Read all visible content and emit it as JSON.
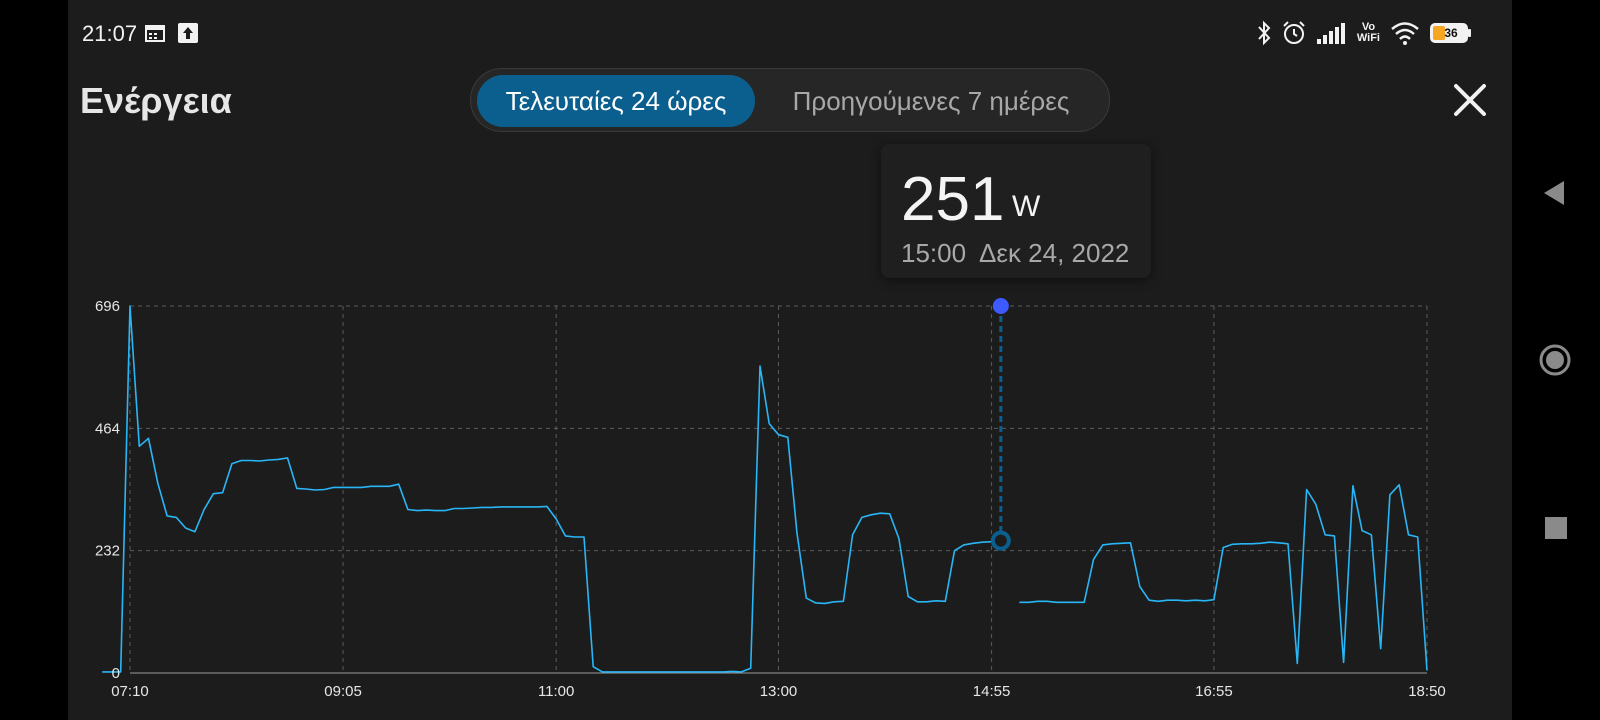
{
  "status_bar": {
    "time": "21:07",
    "battery": "36",
    "vowifi_top": "Vo",
    "vowifi_bottom": "WiFi",
    "icons": [
      "calendar-icon",
      "upload-icon",
      "bluetooth-icon",
      "alarm-icon",
      "cellular-signal-icon",
      "wifi-icon",
      "battery-icon"
    ]
  },
  "header": {
    "title": "Ενέργεια",
    "tabs": [
      {
        "label": "Τελευταίες 24 ώρες",
        "selected": true
      },
      {
        "label": "Προηγούμενες 7 ημέρες",
        "selected": false
      }
    ],
    "close_icon": "close-icon"
  },
  "tooltip": {
    "value": "251",
    "unit": "W",
    "time": "15:00",
    "date": "Δεκ 24, 2022"
  },
  "colors": {
    "accent": "#0a5f8e",
    "line": "#29b6f6",
    "marker": "#3d5afe",
    "background": "#1c1c1c"
  },
  "chart_data": {
    "type": "line",
    "x_tick_labels": [
      "07:10",
      "09:05",
      "11:00",
      "13:00",
      "14:55",
      "16:55",
      "18:50"
    ],
    "x_range": [
      "07:10",
      "18:50"
    ],
    "ylim": [
      0,
      696
    ],
    "y_ticks": [
      0,
      232,
      464,
      696
    ],
    "grid": true,
    "selected_point": {
      "x": "15:00",
      "y": 251
    },
    "series": [
      {
        "values": [
          [
            "06:55",
            2
          ],
          [
            "07:05",
            2
          ],
          [
            "07:10",
            696
          ],
          [
            "07:15",
            430
          ],
          [
            "07:20",
            445
          ],
          [
            "07:25",
            360
          ],
          [
            "07:30",
            298
          ],
          [
            "07:35",
            295
          ],
          [
            "07:40",
            275
          ],
          [
            "07:45",
            268
          ],
          [
            "07:50",
            310
          ],
          [
            "07:55",
            340
          ],
          [
            "08:00",
            342
          ],
          [
            "08:05",
            397
          ],
          [
            "08:10",
            403
          ],
          [
            "08:15",
            403
          ],
          [
            "08:20",
            402
          ],
          [
            "08:25",
            404
          ],
          [
            "08:30",
            405
          ],
          [
            "08:35",
            408
          ],
          [
            "08:40",
            350
          ],
          [
            "08:45",
            349
          ],
          [
            "08:50",
            347
          ],
          [
            "08:55",
            348
          ],
          [
            "09:00",
            352
          ],
          [
            "09:05",
            352
          ],
          [
            "09:10",
            352
          ],
          [
            "09:15",
            352
          ],
          [
            "09:20",
            354
          ],
          [
            "09:25",
            354
          ],
          [
            "09:30",
            354
          ],
          [
            "09:35",
            358
          ],
          [
            "09:40",
            310
          ],
          [
            "09:45",
            308
          ],
          [
            "09:50",
            309
          ],
          [
            "09:55",
            308
          ],
          [
            "10:00",
            308
          ],
          [
            "10:05",
            312
          ],
          [
            "10:10",
            312
          ],
          [
            "10:15",
            313
          ],
          [
            "10:20",
            314
          ],
          [
            "10:25",
            314
          ],
          [
            "10:30",
            315
          ],
          [
            "10:35",
            315
          ],
          [
            "10:40",
            315
          ],
          [
            "10:45",
            315
          ],
          [
            "10:50",
            315
          ],
          [
            "10:55",
            316
          ],
          [
            "11:00",
            292
          ],
          [
            "11:05",
            260
          ],
          [
            "11:10",
            258
          ],
          [
            "11:15",
            258
          ],
          [
            "11:20",
            12
          ],
          [
            "11:25",
            2
          ],
          [
            "11:30",
            2
          ],
          [
            "11:35",
            2
          ],
          [
            "11:40",
            2
          ],
          [
            "11:45",
            2
          ],
          [
            "11:50",
            2
          ],
          [
            "11:55",
            2
          ],
          [
            "12:00",
            2
          ],
          [
            "12:05",
            2
          ],
          [
            "12:10",
            2
          ],
          [
            "12:15",
            2
          ],
          [
            "12:20",
            2
          ],
          [
            "12:25",
            2
          ],
          [
            "12:30",
            2
          ],
          [
            "12:35",
            3
          ],
          [
            "12:40",
            2
          ],
          [
            "12:45",
            9
          ],
          [
            "12:50",
            582
          ],
          [
            "12:55",
            473
          ],
          [
            "13:00",
            452
          ],
          [
            "13:05",
            447
          ],
          [
            "13:10",
            265
          ],
          [
            "13:15",
            142
          ],
          [
            "13:20",
            133
          ],
          [
            "13:25",
            132
          ],
          [
            "13:30",
            135
          ],
          [
            "13:35",
            136
          ],
          [
            "13:40",
            262
          ],
          [
            "13:45",
            295
          ],
          [
            "13:50",
            300
          ],
          [
            "13:55",
            303
          ],
          [
            "14:00",
            302
          ],
          [
            "14:05",
            255
          ],
          [
            "14:10",
            145
          ],
          [
            "14:15",
            135
          ],
          [
            "14:20",
            135
          ],
          [
            "14:25",
            137
          ],
          [
            "14:30",
            136
          ],
          [
            "14:35",
            232
          ],
          [
            "14:40",
            243
          ],
          [
            "14:45",
            246
          ],
          [
            "14:50",
            248
          ],
          [
            "14:55",
            249
          ],
          [
            "15:00",
            251
          ],
          [
            "15:05",
            null
          ],
          [
            "15:10",
            134
          ],
          [
            "15:15",
            134
          ],
          [
            "15:20",
            136
          ],
          [
            "15:25",
            136
          ],
          [
            "15:30",
            134
          ],
          [
            "15:35",
            134
          ],
          [
            "15:40",
            134
          ],
          [
            "15:45",
            134
          ],
          [
            "15:50",
            215
          ],
          [
            "15:55",
            243
          ],
          [
            "16:00",
            245
          ],
          [
            "16:05",
            246
          ],
          [
            "16:10",
            247
          ],
          [
            "16:15",
            164
          ],
          [
            "16:20",
            138
          ],
          [
            "16:25",
            136
          ],
          [
            "16:30",
            138
          ],
          [
            "16:35",
            138
          ],
          [
            "16:40",
            137
          ],
          [
            "16:45",
            138
          ],
          [
            "16:50",
            137
          ],
          [
            "16:55",
            139
          ],
          [
            "17:00",
            238
          ],
          [
            "17:05",
            244
          ],
          [
            "17:10",
            245
          ],
          [
            "17:15",
            245
          ],
          [
            "17:20",
            246
          ],
          [
            "17:25",
            248
          ],
          [
            "17:30",
            247
          ],
          [
            "17:35",
            245
          ],
          [
            "17:40",
            18
          ],
          [
            "17:45",
            348
          ],
          [
            "17:50",
            320
          ],
          [
            "17:55",
            262
          ],
          [
            "18:00",
            260
          ],
          [
            "18:05",
            20
          ],
          [
            "18:10",
            355
          ],
          [
            "18:15",
            270
          ],
          [
            "18:20",
            262
          ],
          [
            "18:25",
            46
          ],
          [
            "18:30",
            338
          ],
          [
            "18:35",
            357
          ],
          [
            "18:40",
            262
          ],
          [
            "18:45",
            258
          ],
          [
            "18:50",
            5
          ]
        ]
      }
    ]
  }
}
